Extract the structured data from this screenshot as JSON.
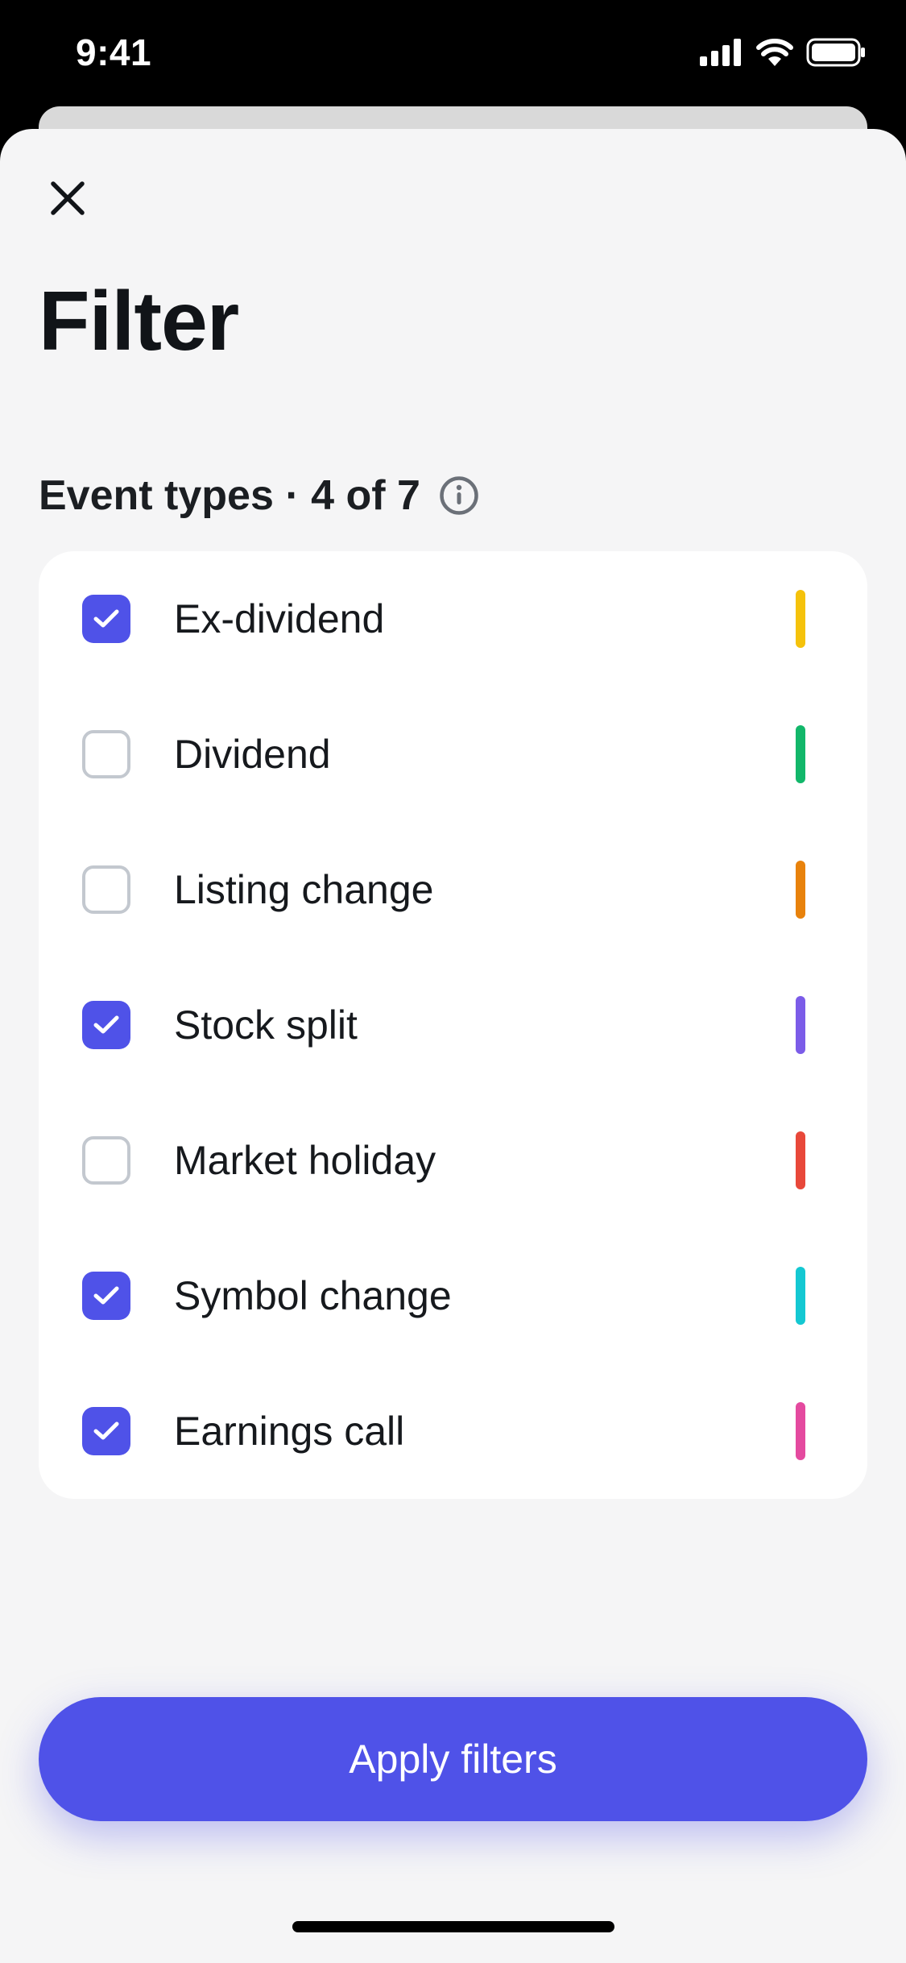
{
  "status_bar": {
    "time": "9:41"
  },
  "sheet": {
    "title": "Filter",
    "section_title": "Event types · 4 of 7",
    "items": [
      {
        "label": "Ex-dividend",
        "checked": true,
        "color": "#f5c20b"
      },
      {
        "label": "Dividend",
        "checked": false,
        "color": "#12b76a"
      },
      {
        "label": "Listing change",
        "checked": false,
        "color": "#e8820c"
      },
      {
        "label": "Stock split",
        "checked": true,
        "color": "#7b5ce8"
      },
      {
        "label": "Market holiday",
        "checked": false,
        "color": "#e8483a"
      },
      {
        "label": "Symbol change",
        "checked": true,
        "color": "#14c8d2"
      },
      {
        "label": "Earnings call",
        "checked": true,
        "color": "#e44a9f"
      }
    ],
    "apply_label": "Apply filters"
  },
  "colors": {
    "accent": "#4f52e8",
    "sheet_bg": "#f5f5f6"
  },
  "icons": [
    "signal-icon",
    "wifi-icon",
    "battery-icon",
    "close-icon",
    "info-icon",
    "check-icon"
  ]
}
